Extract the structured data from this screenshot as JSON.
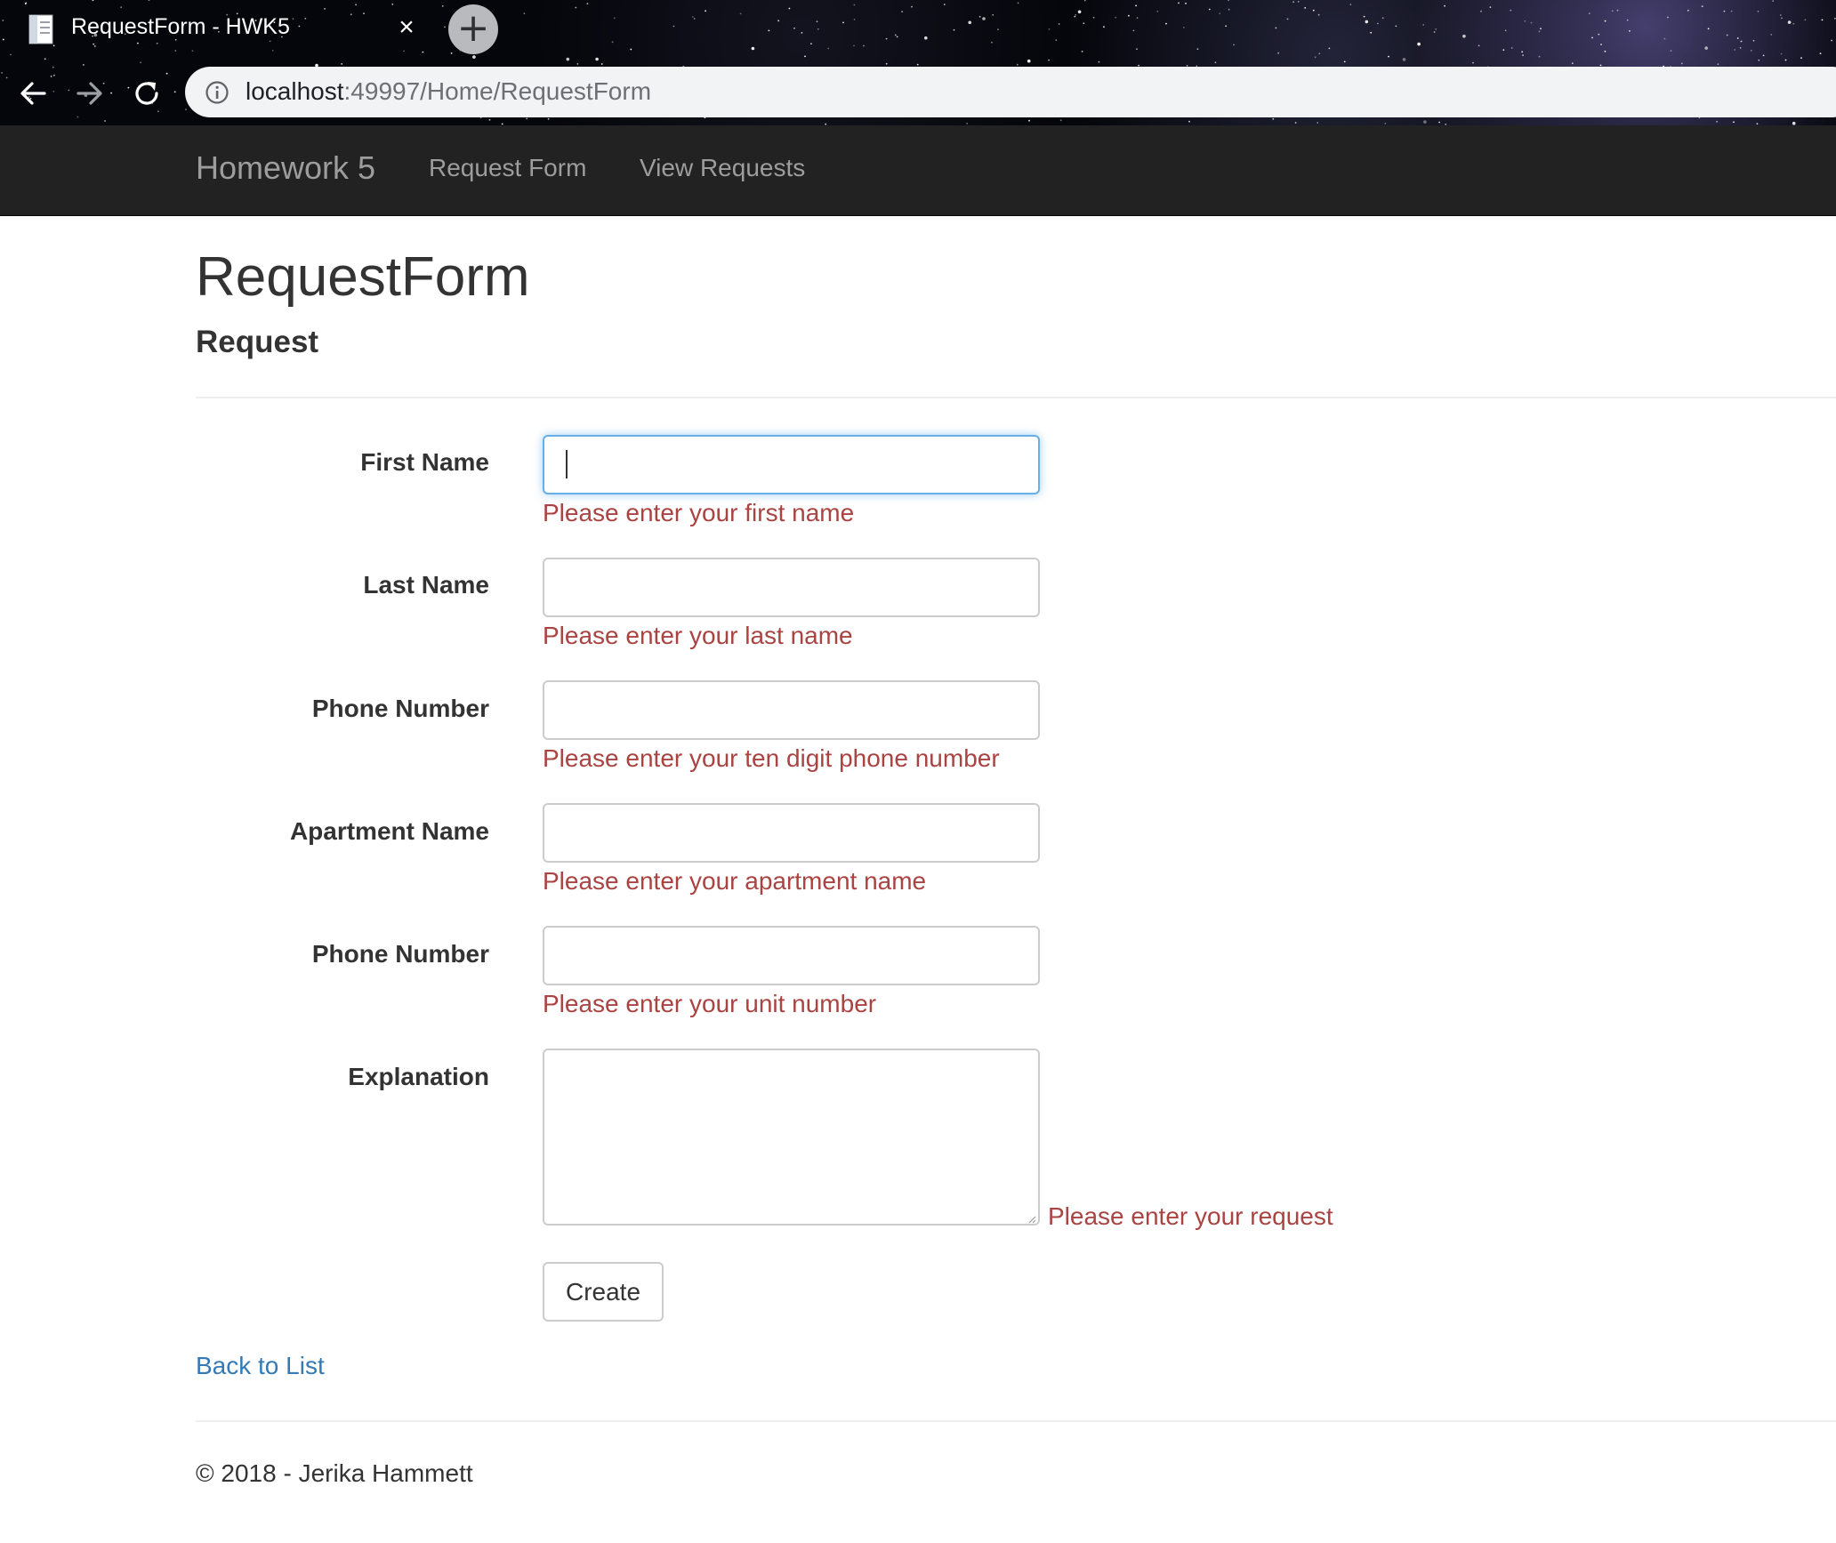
{
  "browser": {
    "tab_title": "RequestForm - HWK5",
    "tab_close_glyph": "×",
    "new_tab_glyph": "+",
    "url_host": "localhost",
    "url_rest": ":49997/Home/RequestForm",
    "icons": {
      "favicon": "page-icon",
      "back": "arrow-left-icon",
      "forward": "arrow-right-icon",
      "reload": "reload-icon",
      "site_info": "info-icon"
    }
  },
  "navbar": {
    "brand": "Homework 5",
    "links": [
      "Request Form",
      "View Requests"
    ]
  },
  "page": {
    "title": "RequestForm",
    "subtitle": "Request"
  },
  "form": {
    "fields": [
      {
        "label": "First Name",
        "value": "",
        "error": "Please enter your first name"
      },
      {
        "label": "Last Name",
        "value": "",
        "error": "Please enter your last name"
      },
      {
        "label": "Phone Number",
        "value": "",
        "error": "Please enter your ten digit phone number"
      },
      {
        "label": "Apartment Name",
        "value": "",
        "error": "Please enter your apartment name"
      },
      {
        "label": "Phone Number",
        "value": "",
        "error": "Please enter your unit number"
      },
      {
        "label": "Explanation",
        "value": "",
        "error": "Please enter your request"
      }
    ],
    "submit_label": "Create"
  },
  "back_link": "Back to List",
  "footer": "© 2018 - Jerika Hammett",
  "colors": {
    "navbar_bg": "#222222",
    "navbar_text": "#9d9d9d",
    "error": "#a94442",
    "link": "#337ab7",
    "focus_border": "#66afe9"
  }
}
